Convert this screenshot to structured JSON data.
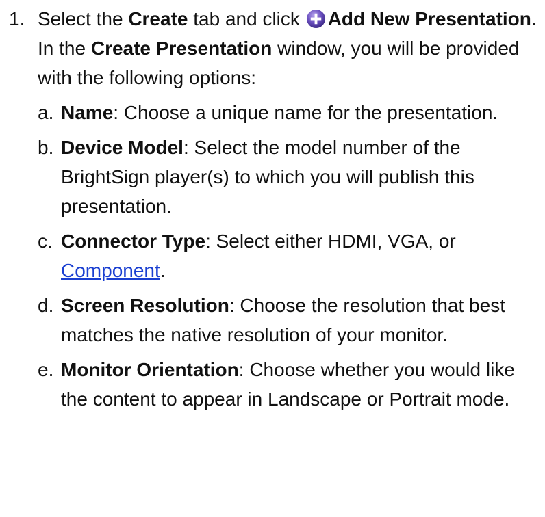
{
  "step": {
    "number": "1.",
    "t1": "Select the ",
    "create_tab": "Create",
    "t2": " tab and click ",
    "add_new_presentation": "Add New Presentation",
    "t3": ". In the ",
    "create_presentation_window": "Create Presentation",
    "t4": " window, you will be provided with the following options:",
    "icon": "plus-circle-icon"
  },
  "options": [
    {
      "letter": "a.",
      "term": "Name",
      "description": ": Choose a unique name for the presentation."
    },
    {
      "letter": "b.",
      "term": "Device Model",
      "description": ": Select the model number of the BrightSign player(s) to which you will publish this presentation."
    },
    {
      "letter": "c.",
      "term": "Connector Type",
      "description": ": Select either HDMI, VGA, or ",
      "link": "Component",
      "after_link": "."
    },
    {
      "letter": "d.",
      "term": "Screen Resolution",
      "description": ": Choose the resolution that best matches the native resolution of your monitor."
    },
    {
      "letter": "e.",
      "term": "Monitor Orientation",
      "description": ": Choose whether you would like the content to appear in Landscape or Portrait mode."
    }
  ],
  "colors": {
    "text": "#111111",
    "link": "#1a3fd1",
    "icon_fill": "#6a4fbf"
  }
}
